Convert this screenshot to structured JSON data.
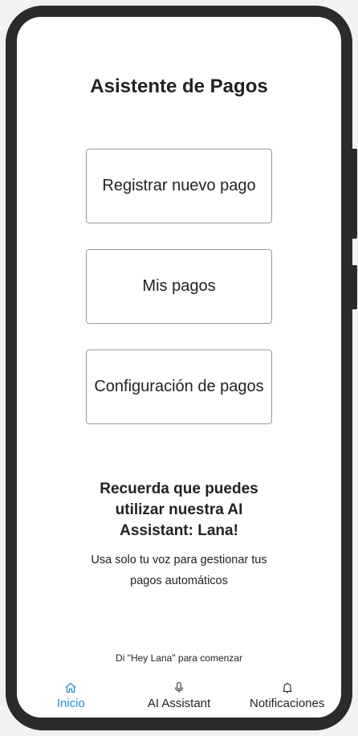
{
  "header": {
    "title": "Asistente de Pagos"
  },
  "actions": [
    {
      "label": "Registrar nuevo pago"
    },
    {
      "label": "Mis pagos"
    },
    {
      "label": "Configuración de pagos"
    }
  ],
  "promo": {
    "title": "Recuerda que puedes utilizar nuestra AI Assistant: Lana!",
    "subtitle": "Usa solo tu voz para gestionar tus pagos automáticos"
  },
  "hint": "Di \"Hey Lana\" para comenzar",
  "nav": {
    "items": [
      {
        "label": "Inicio",
        "icon": "home-icon",
        "active": true
      },
      {
        "label": "AI Assistant",
        "icon": "microphone-icon",
        "active": false
      },
      {
        "label": "Notificaciones",
        "icon": "bell-icon",
        "active": false
      }
    ],
    "active_color": "#1a8fd6"
  }
}
